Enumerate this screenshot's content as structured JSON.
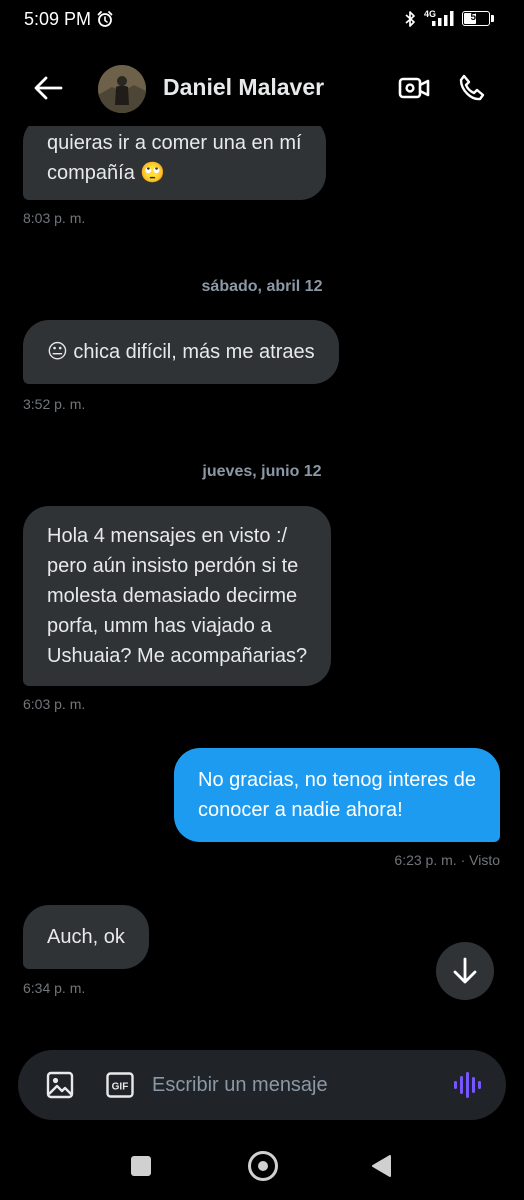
{
  "status_bar": {
    "time": "5:09 PM",
    "network": "4G",
    "battery": "53",
    "battery_level": 0.53
  },
  "header": {
    "contact_name": "Daniel Malaver"
  },
  "messages": [
    {
      "direction": "in",
      "lines": [
        "quieras ir a comer una en mí",
        "compañía 🙄"
      ],
      "time": "8:03 p. m."
    },
    {
      "separator": "sábado, abril 12"
    },
    {
      "direction": "in",
      "lines": [
        "😐 chica difícil, más me atraes"
      ],
      "time": "3:52 p. m."
    },
    {
      "separator": "jueves, junio 12"
    },
    {
      "direction": "in",
      "lines": [
        "Hola 4 mensajes en visto :/",
        "pero aún insisto perdón si te",
        "molesta demasiado decirme",
        "porfa, umm has viajado a",
        "Ushuaia? Me acompañarias?"
      ],
      "time": "6:03 p. m."
    },
    {
      "direction": "out",
      "lines": [
        "No gracias, no tenog interes de",
        "conocer a nadie ahora!"
      ],
      "time": "6:23 p. m. · Visto"
    },
    {
      "direction": "in",
      "lines": [
        "Auch, ok"
      ],
      "time": "6:34 p. m."
    }
  ],
  "composer": {
    "placeholder": "Escribir un mensaje",
    "gif_label": "GIF"
  },
  "colors": {
    "accent": "#1d9bf0",
    "incoming_bubble": "#2f3336",
    "voice_icon": "#7856ff"
  },
  "icons": {
    "back": "arrow-left-icon",
    "video": "video-camera-icon",
    "call": "phone-icon",
    "scroll_down": "arrow-down-icon",
    "image": "image-icon",
    "gif": "gif-icon",
    "voice": "voice-wave-icon"
  }
}
